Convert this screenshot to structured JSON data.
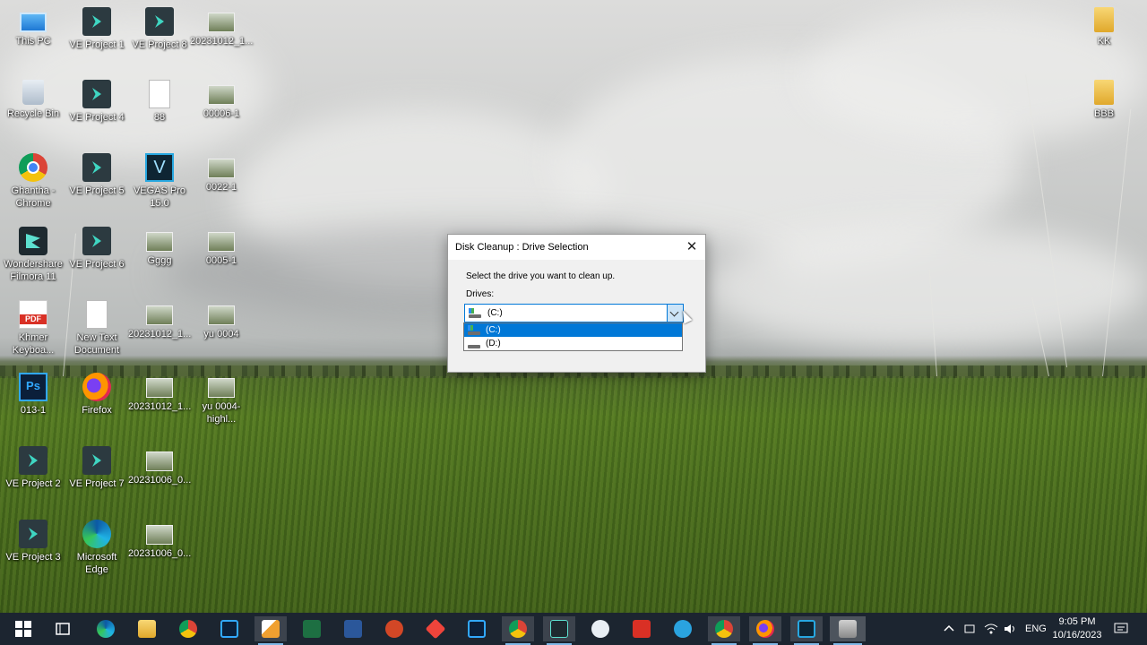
{
  "desktop": {
    "icons": [
      {
        "label": "This PC",
        "icon": "this-pc-icon"
      },
      {
        "label": "Recycle Bin",
        "icon": "recycle-bin-icon"
      },
      {
        "label": "Ghantha - Chrome",
        "icon": "chrome-icon"
      },
      {
        "label": "Wondershare Filmora 11",
        "icon": "filmora-icon"
      },
      {
        "label": "Khmer Keyboa...",
        "icon": "pdf-icon"
      },
      {
        "label": "013-1",
        "icon": "photoshop-file-icon"
      },
      {
        "label": "VE Project 2",
        "icon": "ve-project-icon"
      },
      {
        "label": "VE Project 3",
        "icon": "ve-project-icon"
      },
      {
        "label": "VE Project 1",
        "icon": "ve-project-icon"
      },
      {
        "label": "VE Project 4",
        "icon": "ve-project-icon"
      },
      {
        "label": "VE Project 5",
        "icon": "ve-project-icon"
      },
      {
        "label": "VE Project 6",
        "icon": "ve-project-icon"
      },
      {
        "label": "New Text Document",
        "icon": "text-document-icon"
      },
      {
        "label": "Firefox",
        "icon": "firefox-icon"
      },
      {
        "label": "VE Project 7",
        "icon": "ve-project-icon"
      },
      {
        "label": "Microsoft Edge",
        "icon": "edge-icon"
      },
      {
        "label": "VE Project 8",
        "icon": "ve-project-icon"
      },
      {
        "label": "88",
        "icon": "text-document-icon"
      },
      {
        "label": "VEGAS Pro 15.0",
        "icon": "vegas-pro-icon"
      },
      {
        "label": "Gggg",
        "icon": "photo-icon"
      },
      {
        "label": "20231012_1...",
        "icon": "photo-icon"
      },
      {
        "label": "20231012_1...",
        "icon": "photo-icon"
      },
      {
        "label": "20231006_0...",
        "icon": "photo-icon"
      },
      {
        "label": "20231006_0...",
        "icon": "photo-icon"
      },
      {
        "label": "20231012_1...",
        "icon": "photo-icon"
      },
      {
        "label": "00006-1",
        "icon": "photo-icon"
      },
      {
        "label": "0022-1",
        "icon": "photo-icon"
      },
      {
        "label": "0005-1",
        "icon": "photo-icon"
      },
      {
        "label": "yu 0004",
        "icon": "photo-icon"
      },
      {
        "label": "yu 0004-highl...",
        "icon": "photo-icon"
      },
      {
        "label": "KK",
        "icon": "folder-icon"
      },
      {
        "label": "BBB",
        "icon": "folder-icon"
      }
    ]
  },
  "dialog": {
    "title": "Disk Cleanup : Drive Selection",
    "close_glyph": "✕",
    "message": "Select the drive you want to clean up.",
    "drives_label": "Drives:",
    "selected_drive": "(C:)",
    "options": [
      "(C:)",
      "(D:)"
    ]
  },
  "taskbar": {
    "apps": [
      "start-icon",
      "task-view-icon",
      "edge-icon",
      "file-explorer-icon",
      "chrome-icon",
      "photoshop-icon",
      "paint-icon",
      "excel-icon",
      "word-icon",
      "powerpoint-icon",
      "anydesk-icon",
      "photoshop-icon",
      "chrome-icon",
      "filmora-icon",
      "app-icon",
      "acrobat-icon",
      "telegram-icon",
      "chrome-icon",
      "firefox-icon",
      "vegas-icon",
      "cleanup-icon"
    ],
    "colors": {
      "background": "#1c2530",
      "accent": "#0078d7"
    },
    "language": "ENG",
    "time": "9:05 PM",
    "date": "10/16/2023"
  }
}
